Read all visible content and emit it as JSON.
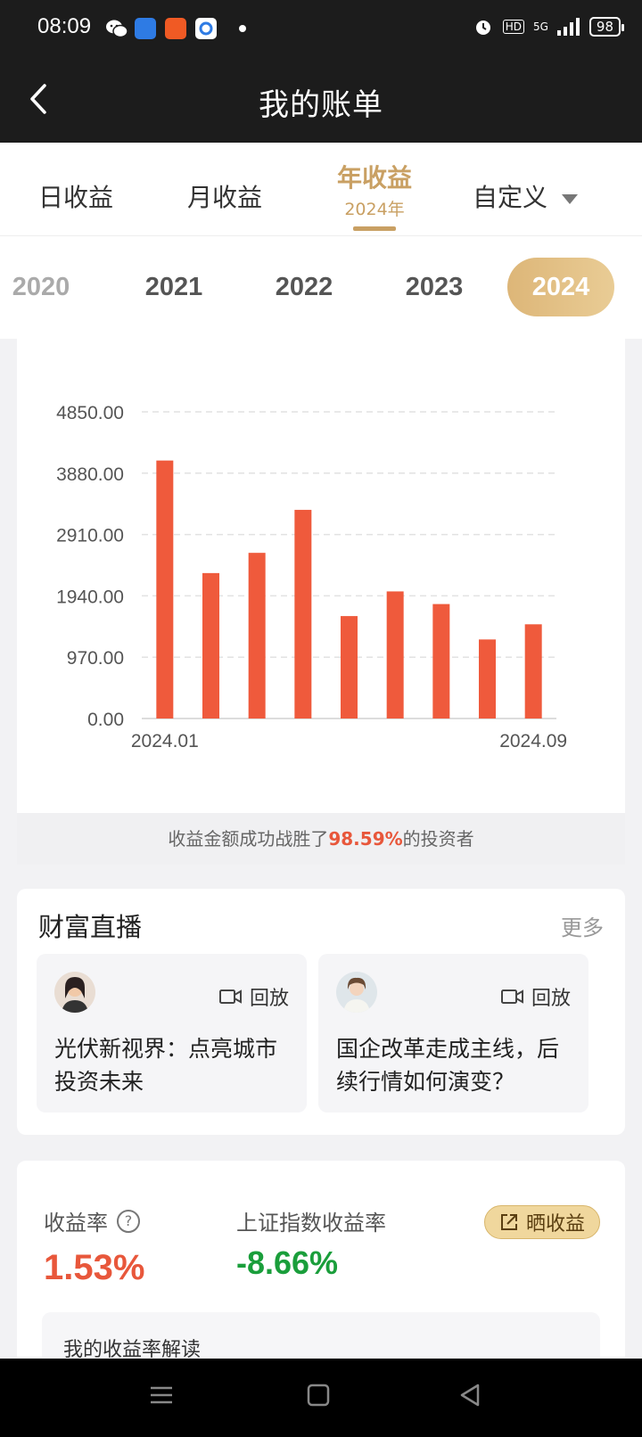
{
  "status_bar": {
    "time": "08:09",
    "hd": "HD",
    "network": "5G",
    "battery": "98"
  },
  "nav": {
    "title": "我的账单"
  },
  "tabs": [
    {
      "label": "日收益"
    },
    {
      "label": "月收益"
    },
    {
      "label": "年收益",
      "sub": "2024年"
    },
    {
      "label": "自定义"
    }
  ],
  "years": [
    "2020",
    "2021",
    "2022",
    "2023",
    "2024"
  ],
  "chart_data": {
    "type": "bar",
    "categories": [
      "2024.01",
      "2024.02",
      "2024.03",
      "2024.04",
      "2024.05",
      "2024.06",
      "2024.07",
      "2024.08",
      "2024.09"
    ],
    "values": [
      4080,
      2300,
      2620,
      3300,
      1620,
      2010,
      1810,
      1250,
      1490
    ],
    "y_ticks": [
      "0.00",
      "970.00",
      "1940.00",
      "2910.00",
      "3880.00",
      "4850.00"
    ],
    "x_tick_labels": [
      "2024.01",
      "2024.09"
    ],
    "ylim": [
      0,
      4850
    ],
    "bar_color": "#ef5a3c",
    "grid": true
  },
  "beat": {
    "prefix": "收益金额成功战胜了",
    "pct": "98.59%",
    "suffix": "的投资者"
  },
  "live": {
    "title": "财富直播",
    "more": "更多",
    "items": [
      {
        "replay": "回放",
        "text": "光伏新视界：点亮城市投资未来"
      },
      {
        "replay": "回放",
        "text": "国企改革走成主线，后续行情如何演变？"
      }
    ]
  },
  "rate": {
    "label": "收益率",
    "help_icon": "?",
    "value": "1.53%",
    "index_label": "上证指数收益率",
    "index_value": "-8.66%",
    "share": "晒收益",
    "interpret": "我的收益率解读"
  },
  "colors": {
    "accent": "#c9a063",
    "positive": "#e8573b",
    "negative": "#1a9e3b"
  }
}
